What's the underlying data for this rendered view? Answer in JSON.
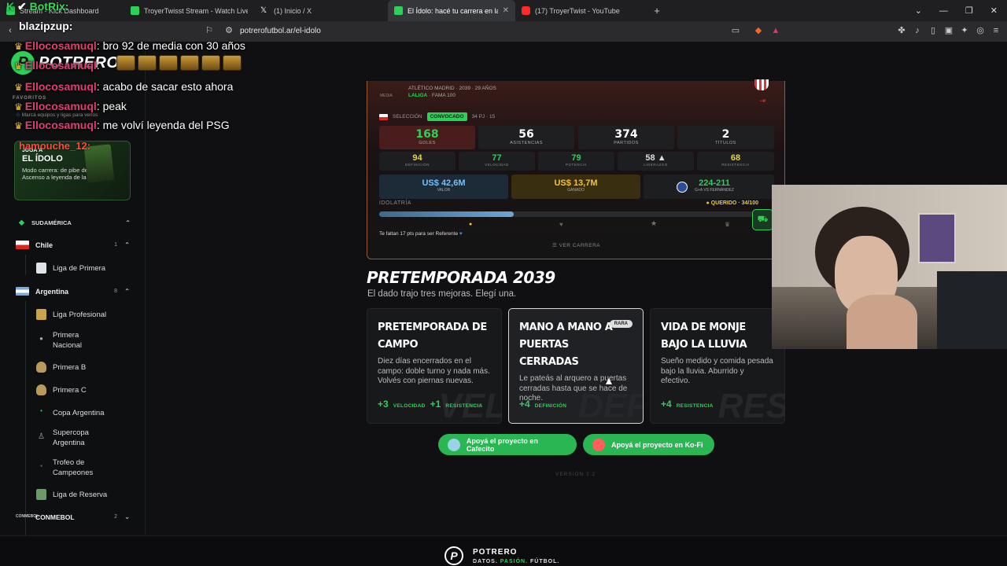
{
  "browser": {
    "tabs": [
      {
        "label": "Stream - Kick Dashboard",
        "color": "#2bd158"
      },
      {
        "label": "TroyerTwisst Stream - Watch Live on K",
        "color": "#2bd158"
      },
      {
        "label": "(1) Inicio / X",
        "color": "#ffffff"
      },
      {
        "label": "El Ídolo: hacé tu carrera en la Lig",
        "color": "#2bd158",
        "active": true
      },
      {
        "label": "(17) TroyerTwist - YouTube",
        "color": "#ff2a2a"
      }
    ],
    "url": "potrerofutbol.ar/el-idolo"
  },
  "chat": {
    "bot_line": "BotRix:",
    "blazi": "blazipzup:",
    "messages": [
      {
        "user": "Ellocosamuql",
        "text": ": bro 92 de media con 30 años"
      },
      {
        "user": "Ellocosamuql",
        "text": ":"
      },
      {
        "user": "Ellocosamuql",
        "text": ": acabo de sacar esto ahora"
      },
      {
        "user": "Ellocosamuql",
        "text": ": peak"
      },
      {
        "user": "Ellocosamuql",
        "text": ": me volví leyenda del PSG"
      }
    ],
    "hamouche": "hamouche_12:"
  },
  "sidebar": {
    "brand": "POTRERO",
    "favorites_heading": "FAVORITOS",
    "favorites_hint": "Marcá equipos y ligas para verlos",
    "promo": {
      "kicker": "JUGÁ A",
      "title": "EL ÍDOLO",
      "desc": "Modo carrera: de pibe del Ascenso a leyenda de la Liga"
    },
    "region": "SUDAMÉRICA",
    "countries": [
      {
        "name": "Chile",
        "count": "1",
        "leagues": [
          "Liga de Primera"
        ]
      },
      {
        "name": "Argentina",
        "count": "8",
        "leagues": [
          "Liga Profesional",
          "Primera Nacional",
          "Primera B",
          "Primera C",
          "Copa Argentina",
          "Supercopa Argentina",
          "Trofeo de Campeones",
          "Liga de Reserva"
        ]
      },
      {
        "name": "CONMEBOL",
        "count": "2",
        "leagues": []
      }
    ]
  },
  "player": {
    "meta": "ATLÉTICO MADRID · 2039 · 29 AÑOS",
    "league": "LALIGA",
    "fame": "FAMA 100",
    "media_label": "MEDIA",
    "seleccion": "SELECCIÓN",
    "convocado": "CONVOCADO",
    "pj": "34 PJ · 15",
    "stats": [
      {
        "value": "168",
        "label": "GOLES"
      },
      {
        "value": "56",
        "label": "ASISTENCIAS"
      },
      {
        "value": "374",
        "label": "PARTIDOS"
      },
      {
        "value": "2",
        "label": "TÍTULOS"
      }
    ],
    "attrs": [
      {
        "value": "94",
        "label": "DEFINICIÓN"
      },
      {
        "value": "77",
        "label": "VELOCIDAD"
      },
      {
        "value": "79",
        "label": "POTENCIA"
      },
      {
        "value": "58 ▲",
        "label": "LIDERAZGO"
      },
      {
        "value": "68",
        "label": "RESISTENCIA"
      }
    ],
    "valor": {
      "value": "US$ 42,6M",
      "label": "VALOR"
    },
    "ganado": {
      "value": "US$ 13,7M",
      "label": "GANADO"
    },
    "rival": {
      "value": "224-211",
      "label": "G+A VS FERNÁNDEZ"
    },
    "idolatria_label": "IDOLATRÍA",
    "idolatria_status": "QUERIDO · 34/100",
    "idolatria_progress": 0.34,
    "idolatria_note": "Te faltan 17 pts para ser Referente",
    "ver_carrera": "VER CARRERA"
  },
  "pretemporada": {
    "title": "PRETEMPORADA 2039",
    "subtitle": "El dado trajo tres mejoras. Elegí una.",
    "options": [
      {
        "title": "Pretemporada de campo",
        "desc": "Diez días encerrados en el campo: doble turno y nada más. Volvés con piernas nuevas.",
        "bonus1_n": "+3",
        "bonus1_s": "VELOCIDAD",
        "bonus2_n": "+1",
        "bonus2_s": "RESISTENCIA",
        "bg": "VEL"
      },
      {
        "title": "Mano a mano a puertas cerradas",
        "desc": "Le pateás al arquero a puertas cerradas hasta que se hace de noche.",
        "bonus1_n": "+4",
        "bonus1_s": "DEFINICIÓN",
        "bg": "DEF",
        "badge": "RARA"
      },
      {
        "title": "Vida de monje bajo la lluvia",
        "desc": "Sueño medido y comida pesada bajo la lluvia. Aburrido y efectivo.",
        "bonus1_n": "+4",
        "bonus1_s": "RESISTENCIA",
        "bg": "RES"
      }
    ]
  },
  "donate": {
    "cafecito": "Apoyá el proyecto en Cafecito",
    "kofi": "Apoyá el proyecto en Ko-Fi"
  },
  "version": "VERSIÓN 2.2",
  "footer": {
    "name": "POTRERO",
    "tag1": "DATOS.",
    "tag2": "PASIÓN.",
    "tag3": "FÚTBOL."
  }
}
